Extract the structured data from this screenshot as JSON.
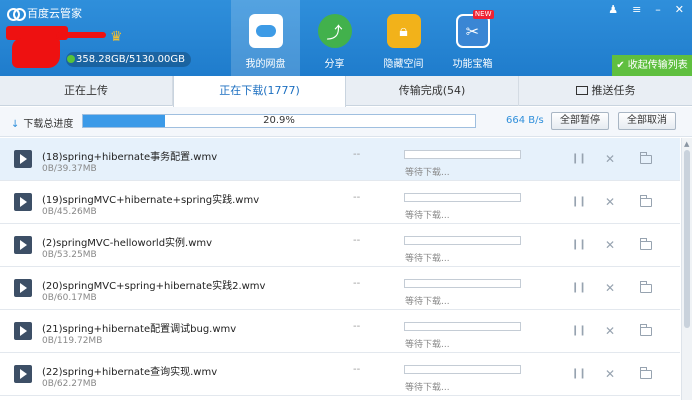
{
  "app": {
    "title": "百度云管家"
  },
  "user": {
    "quota": "358.28GB/5130.00GB"
  },
  "nav": [
    {
      "label": "我的网盘",
      "icon": "cloud-icon"
    },
    {
      "label": "分享",
      "icon": "share-icon"
    },
    {
      "label": "隐藏空间",
      "icon": "lock-icon"
    },
    {
      "label": "功能宝箱",
      "icon": "toolbox-icon",
      "badge": "NEW"
    }
  ],
  "window": {
    "collapse_label": "收起传输列表"
  },
  "tabs": [
    {
      "label": "正在上传"
    },
    {
      "label": "正在下载(1777)"
    },
    {
      "label": "传输完成(54)"
    },
    {
      "label": "推送任务"
    }
  ],
  "total": {
    "label": "下载总进度",
    "percent_text": "20.9%",
    "percent": 20.9,
    "speed": "664 B/s",
    "pause_all": "全部暂停",
    "cancel_all": "全部取消"
  },
  "files": [
    {
      "name": "(18)spring+hibernate事务配置.wmv",
      "size": "0B/39.37MB",
      "speed": "--",
      "status": "等待下载..."
    },
    {
      "name": "(19)springMVC+hibernate+spring实践.wmv",
      "size": "0B/45.26MB",
      "speed": "--",
      "status": "等待下载..."
    },
    {
      "name": "(2)springMVC-helloworld实例.wmv",
      "size": "0B/53.25MB",
      "speed": "--",
      "status": "等待下载..."
    },
    {
      "name": "(20)springMVC+spring+hibernate实践2.wmv",
      "size": "0B/60.17MB",
      "speed": "--",
      "status": "等待下载..."
    },
    {
      "name": "(21)spring+hibernate配置调试bug.wmv",
      "size": "0B/119.72MB",
      "speed": "--",
      "status": "等待下载..."
    },
    {
      "name": "(22)spring+hibernate查询实现.wmv",
      "size": "0B/62.27MB",
      "speed": "--",
      "status": "等待下载..."
    }
  ],
  "colors": {
    "header": "#2585d6",
    "accent": "#3b9ae8",
    "collapse": "#5fbf3f",
    "selected_row": "#e6f1fb"
  }
}
